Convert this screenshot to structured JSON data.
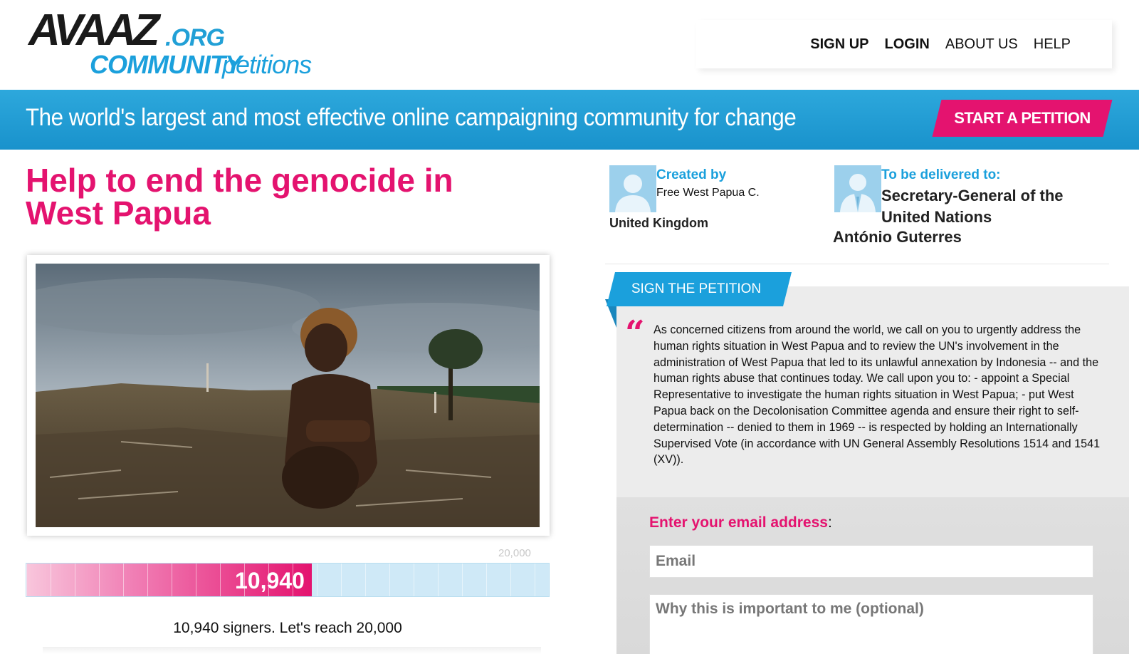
{
  "header": {
    "logo": {
      "wordmark": "AVAAZ",
      "org": ".ORG",
      "community": "COMMUNITY",
      "petitions": "petitions"
    },
    "nav": [
      {
        "label": "SIGN UP"
      },
      {
        "label": "LOGIN"
      },
      {
        "label": "ABOUT US"
      },
      {
        "label": "HELP"
      }
    ]
  },
  "banner": {
    "tagline": "The world's largest and most effective online campaigning community for change",
    "cta_label": "START A PETITION"
  },
  "petition": {
    "title": "Help to end the genocide in West Papua",
    "progress": {
      "signers": 10940,
      "signers_display": "10,940",
      "goal": 20000,
      "goal_display": "20,000",
      "fraction": 0.547,
      "summary": "10,940 signers. Let's reach 20,000"
    }
  },
  "creator": {
    "label": "Created by",
    "name": "Free West Papua C.",
    "country": "United Kingdom"
  },
  "recipient": {
    "label": "To be delivered to:",
    "title": "Secretary-General of the United Nations",
    "name": "António Guterres"
  },
  "sign": {
    "tab_label": "SIGN THE PETITION",
    "quote_mark": "“",
    "text": "As concerned citizens from around the world, we call on you to urgently address the human rights situation in West Papua and to review the UN's involvement in the administration of West Papua that led to its unlawful annexation by Indonesia -- and the human rights abuse that continues today. We call upon you to: - appoint a Special Representative to investigate the human rights situation in West Papua; - put West Papua back on the Decolonisation Committee agenda and ensure their right to self-determination -- denied to them in 1969 -- is respected by holding an Internationally Supervised Vote (in accordance with UN General Assembly Resolutions 1514 and 1541 (XV)).",
    "email_label": "Enter your email address",
    "email_label_suffix": ":",
    "email_placeholder": "Email",
    "reason_placeholder": "Why this is important to me (optional)"
  },
  "colors": {
    "brand_blue": "#1ba0dc",
    "brand_pink": "#e4136f"
  },
  "icons": {
    "creator_avatar": "person-silhouette-icon",
    "recipient_avatar": "person-suit-silhouette-icon"
  }
}
